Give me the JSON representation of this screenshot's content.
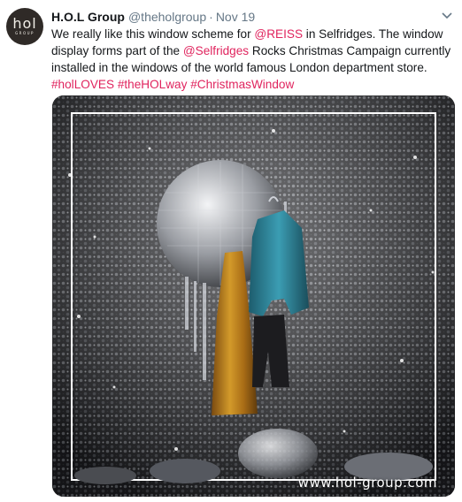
{
  "tweet": {
    "author_name": "H.O.L Group",
    "author_handle": "@theholgroup",
    "separator": "·",
    "timestamp": "Nov 19",
    "avatar": {
      "logo_text": "hol",
      "logo_subtext": "GROUP"
    },
    "text": {
      "part1": "We really like this window scheme for ",
      "mention1": "@REISS",
      "part2": " in Selfridges. The window display forms part of the ",
      "mention2": "@Selfridges",
      "part3": " Rocks Christmas Campaign currently installed in the windows of the world famous London department store. ",
      "hashtag1": "#holLOVES",
      "hashtag2": "#theHOLway",
      "hashtag3": "#ChristmasWindow"
    },
    "media": {
      "watermark": "www.hol-group.com"
    }
  },
  "colors": {
    "link": "#e0245e",
    "muted": "#657786",
    "text": "#14171a"
  },
  "icons": {
    "menu": "chevron-down-icon"
  }
}
